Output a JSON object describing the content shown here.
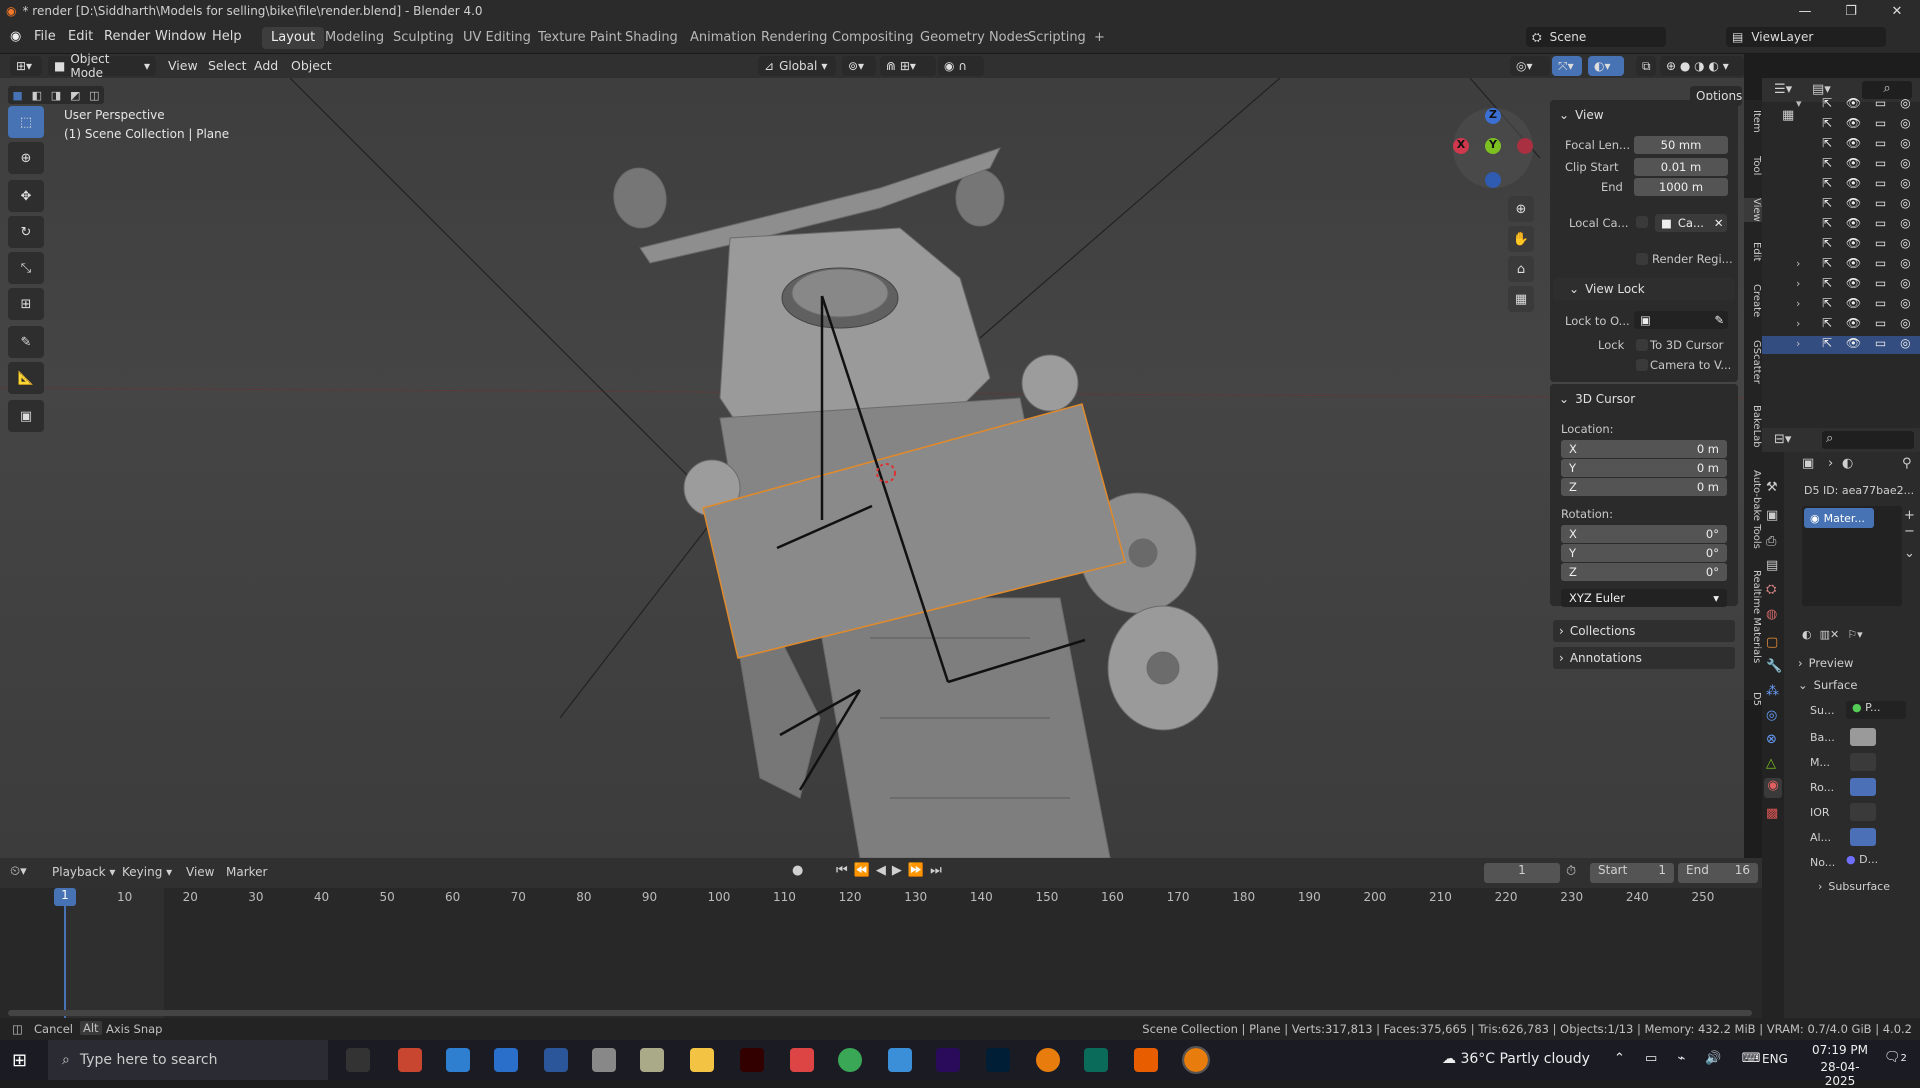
{
  "window": {
    "title": "* render [D:\\Siddharth\\Models for selling\\bike\\file\\render.blend] - Blender 4.0",
    "controls": [
      "—",
      "❐",
      "✕"
    ]
  },
  "menubar": {
    "items": [
      "File",
      "Edit",
      "Render",
      "Window",
      "Help"
    ],
    "workspaces": [
      "Layout",
      "Modeling",
      "Sculpting",
      "UV Editing",
      "Texture Paint",
      "Shading",
      "Animation",
      "Rendering",
      "Compositing",
      "Geometry Nodes",
      "Scripting",
      "+"
    ],
    "scene": "Scene",
    "view_layer": "ViewLayer"
  },
  "viewport_header": {
    "mode": "Object Mode",
    "menus": [
      "View",
      "Select",
      "Add",
      "Object"
    ],
    "orientation": "Global",
    "options": "Options"
  },
  "viewport": {
    "perspective": "User Perspective",
    "collection": "(1) Scene Collection | Plane"
  },
  "gizmo": {
    "x": "X",
    "y": "Y",
    "z": "Z"
  },
  "npanel": {
    "view": {
      "title": "View",
      "focal_label": "Focal Len...",
      "focal_value": "50 mm",
      "clip_start_label": "Clip Start",
      "clip_start_value": "0.01 m",
      "end_label": "End",
      "end_value": "1000 m",
      "local_camera_label": "Local Ca...",
      "local_camera_value": "Ca...",
      "render_region": "Render Regi..."
    },
    "view_lock": {
      "title": "View Lock",
      "lock_to_label": "Lock to O...",
      "lock_label": "Lock",
      "to_cursor": "To 3D Cursor",
      "camera_to_view": "Camera to V..."
    },
    "cursor": {
      "title": "3D Cursor",
      "location": "Location:",
      "rotation": "Rotation:",
      "lx": "0 m",
      "ly": "0 m",
      "lz": "0 m",
      "rx": "0°",
      "ry": "0°",
      "rz": "0°",
      "mode": "XYZ Euler",
      "X": "X",
      "Y": "Y",
      "Z": "Z"
    },
    "collections": "Collections",
    "annotations": "Annotations"
  },
  "side_tabs": [
    "Item",
    "Tool",
    "View",
    "Edit",
    "Create",
    "GScatter",
    "BakeLab",
    "Auto-bake Tools",
    "Realtime Materials",
    "D5"
  ],
  "properties": {
    "d5_id": "D5 ID: aea77bae2...",
    "material": "Mater...",
    "preview": "Preview",
    "surface": "Surface",
    "surface_label": "Su...",
    "surface_value": "P...",
    "inputs": [
      "Ba...",
      "M...",
      "Ro...",
      "IOR",
      "Al...",
      "No..."
    ],
    "normal_value": "D...",
    "subsurface": "Subsurface"
  },
  "timeline": {
    "menus": [
      "Playback",
      "Keying",
      "View",
      "Marker"
    ],
    "current_frame": "1",
    "start_label": "Start",
    "start": "1",
    "end_label": "End",
    "end": "16",
    "ticks": [
      "1",
      "10",
      "20",
      "30",
      "40",
      "50",
      "60",
      "70",
      "80",
      "90",
      "100",
      "110",
      "120",
      "130",
      "140",
      "150",
      "160",
      "170",
      "180",
      "190",
      "200",
      "210",
      "220",
      "230",
      "240",
      "250"
    ]
  },
  "status": {
    "left_cancel": "Cancel",
    "left_alt": "Alt",
    "left_snap": "Axis Snap",
    "stats": "Scene Collection | Plane | Verts:317,813 | Faces:375,665 | Tris:626,783 | Objects:1/13 | Memory: 432.2 MiB | VRAM: 0.7/4.0 GiB | 4.0.2"
  },
  "taskbar": {
    "search": "Type here to search",
    "weather": "36°C  Partly cloudy",
    "lang": "ENG",
    "time": "07:19 PM",
    "date": "28-04-2025",
    "notif": "2"
  }
}
